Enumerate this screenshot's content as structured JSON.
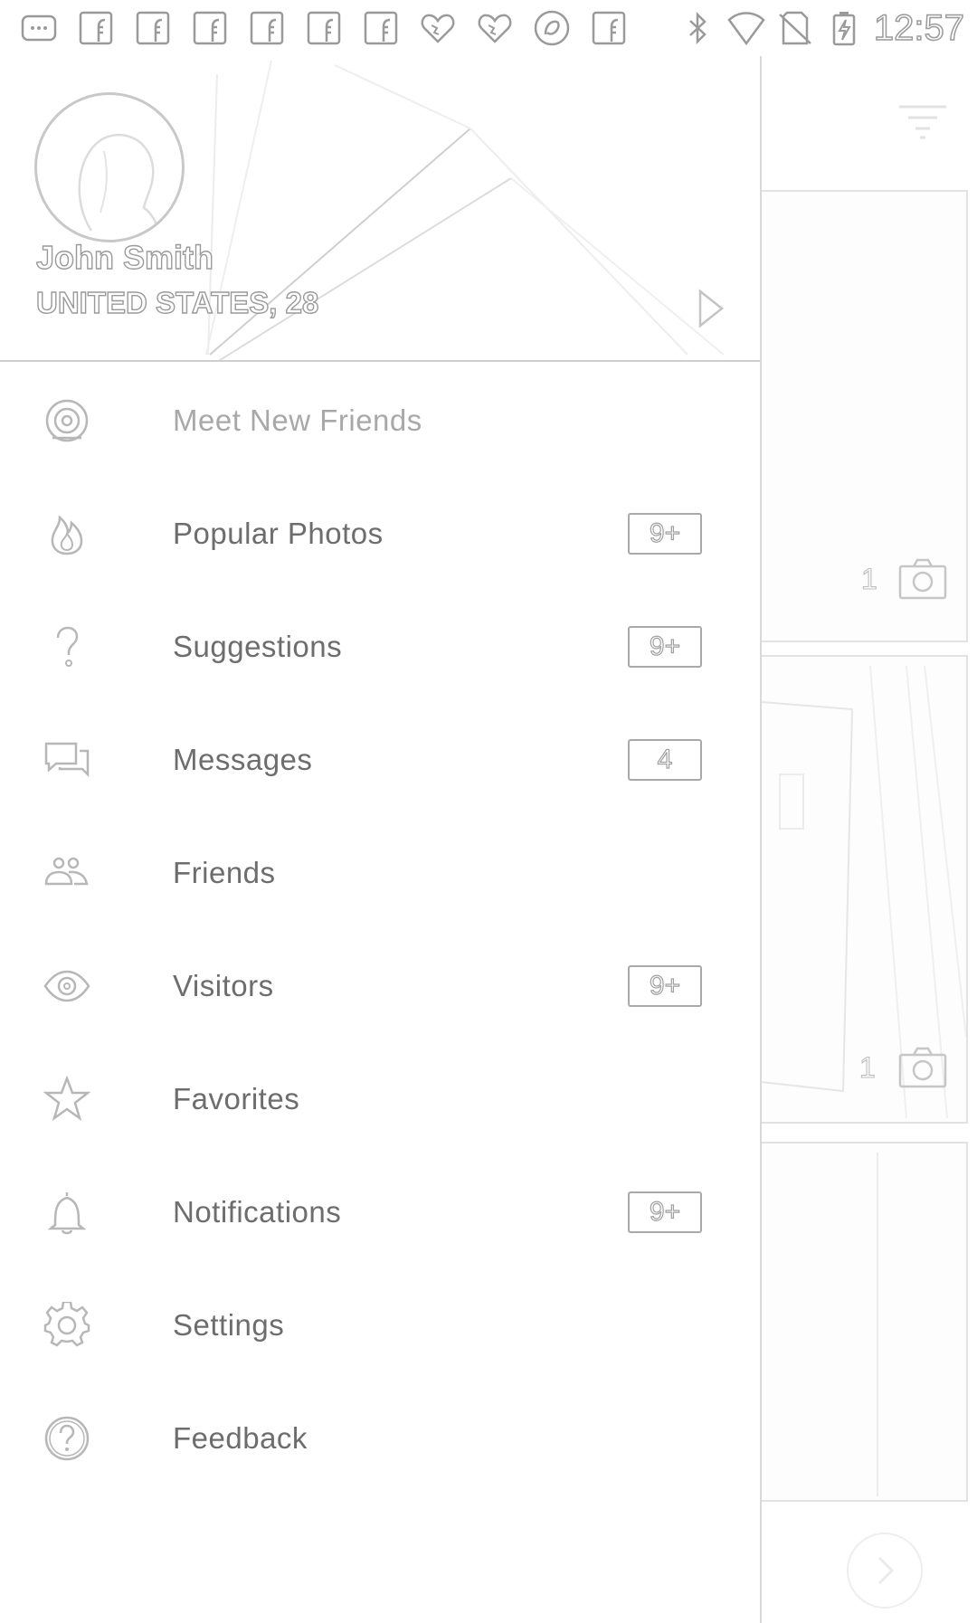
{
  "status_bar": {
    "time": "12:57",
    "left_icons": [
      "more-apps-icon",
      "facebook-icon",
      "facebook-icon",
      "facebook-icon",
      "facebook-icon",
      "facebook-icon",
      "facebook-icon",
      "puzzle-heart-icon",
      "puzzle-heart-icon",
      "app-circle-icon",
      "facebook-icon"
    ],
    "right_icons": [
      "bluetooth-icon",
      "wifi-icon",
      "no-sim-icon",
      "battery-charging-icon"
    ]
  },
  "drawer": {
    "profile": {
      "name": "John Smith",
      "meta": "UNITED STATES, 28"
    },
    "menu": [
      {
        "id": "meet-new-friends",
        "label": "Meet New Friends",
        "icon": "radar-icon",
        "badge": null
      },
      {
        "id": "popular-photos",
        "label": "Popular Photos",
        "icon": "flame-icon",
        "badge": "9+"
      },
      {
        "id": "suggestions",
        "label": "Suggestions",
        "icon": "question-icon",
        "badge": "9+"
      },
      {
        "id": "messages",
        "label": "Messages",
        "icon": "chat-icon",
        "badge": "4"
      },
      {
        "id": "friends",
        "label": "Friends",
        "icon": "people-icon",
        "badge": null
      },
      {
        "id": "visitors",
        "label": "Visitors",
        "icon": "eye-icon",
        "badge": "9+"
      },
      {
        "id": "favorites",
        "label": "Favorites",
        "icon": "star-icon",
        "badge": null
      },
      {
        "id": "notifications",
        "label": "Notifications",
        "icon": "bell-icon",
        "badge": "9+"
      },
      {
        "id": "settings",
        "label": "Settings",
        "icon": "gear-icon",
        "badge": null
      },
      {
        "id": "feedback",
        "label": "Feedback",
        "icon": "help-circle-icon",
        "badge": null
      }
    ]
  },
  "background": {
    "cards": [
      {
        "photo_count": "1"
      },
      {
        "photo_count": "1"
      }
    ]
  },
  "colors": {
    "line": "#a9a9a9",
    "label": "#6d6d6d",
    "label_dim": "#a8a8a8",
    "divider": "#cfcfcf"
  }
}
